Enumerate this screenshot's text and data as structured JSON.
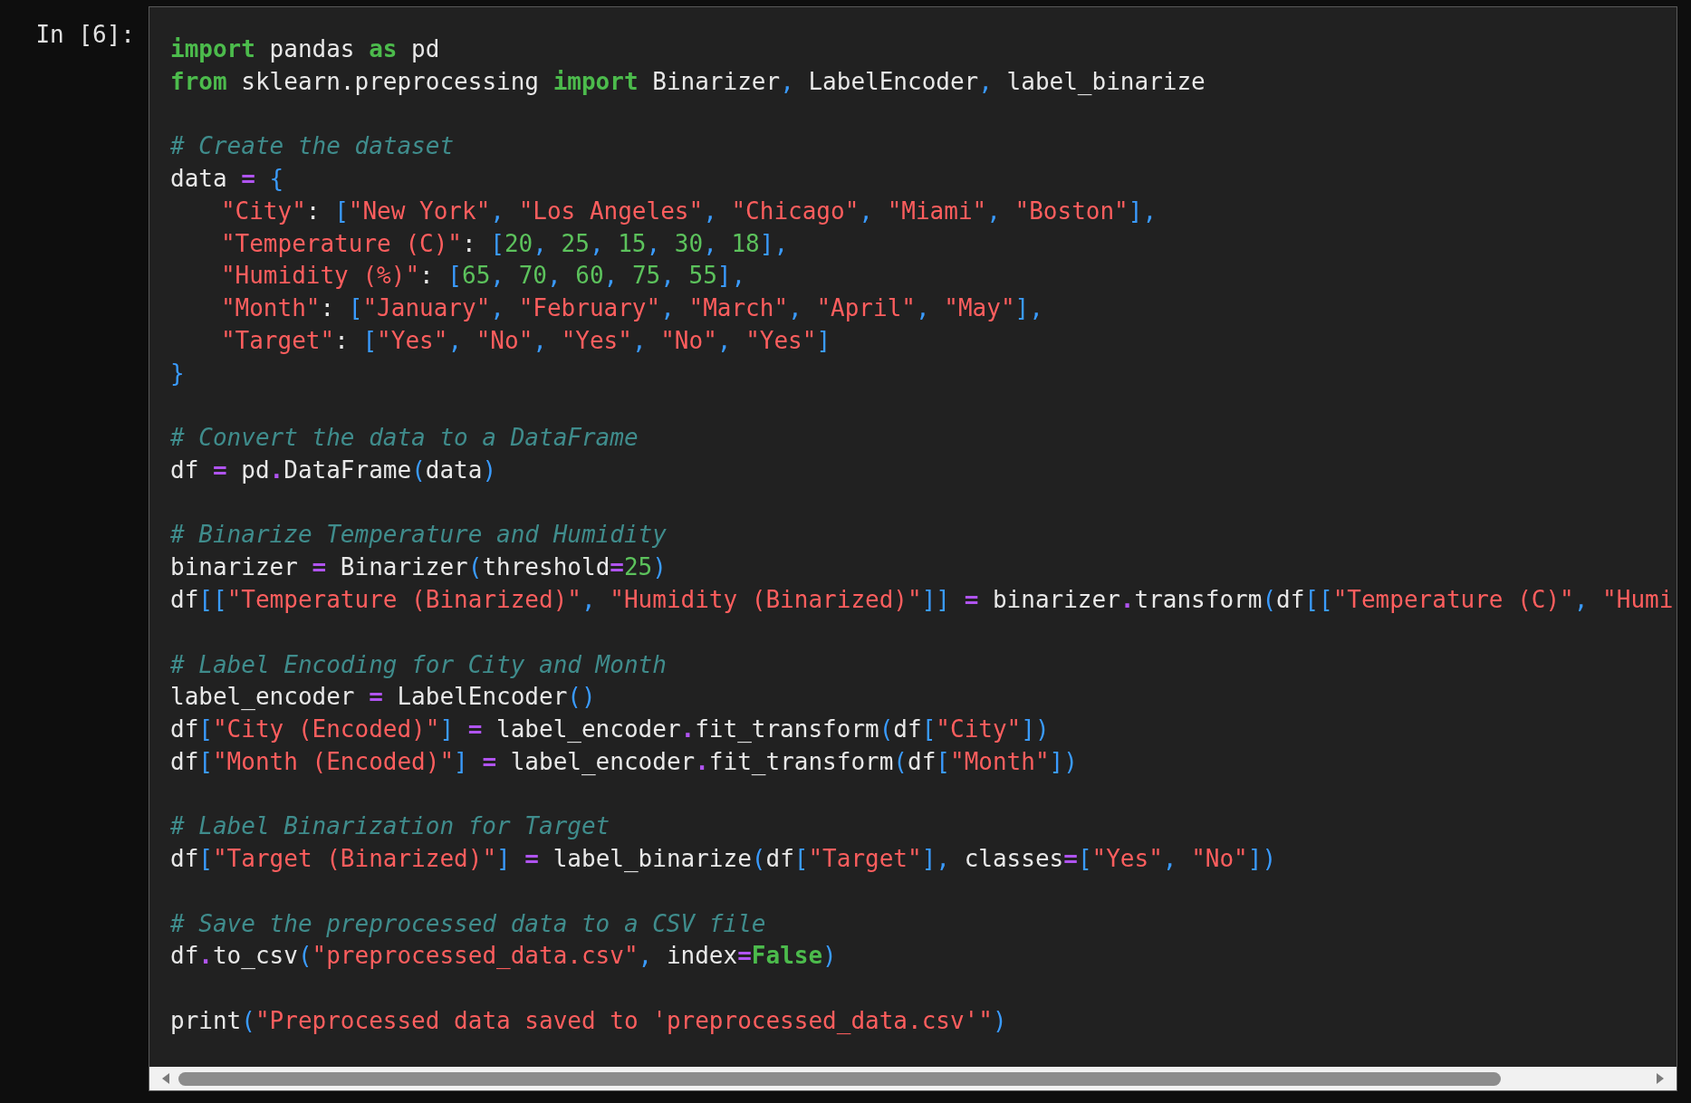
{
  "prompt": "In [6]:",
  "lines": [
    {
      "kind": "code",
      "tokens": [
        {
          "kind": "kw",
          "text": "import"
        },
        {
          "kind": "plain",
          "text": " pandas "
        },
        {
          "kind": "kw",
          "text": "as"
        },
        {
          "kind": "plain",
          "text": " pd"
        }
      ]
    },
    {
      "kind": "code",
      "tokens": [
        {
          "kind": "kw",
          "text": "from"
        },
        {
          "kind": "plain",
          "text": " sklearn.preprocessing "
        },
        {
          "kind": "kw",
          "text": "import"
        },
        {
          "kind": "plain",
          "text": " Binarizer"
        },
        {
          "kind": "punct",
          "text": ", "
        },
        {
          "kind": "plain",
          "text": "LabelEncoder"
        },
        {
          "kind": "punct",
          "text": ", "
        },
        {
          "kind": "plain",
          "text": "label_binarize"
        }
      ]
    },
    {
      "kind": "blank"
    },
    {
      "kind": "code",
      "tokens": [
        {
          "kind": "comment",
          "text": "# Create the dataset"
        }
      ]
    },
    {
      "kind": "code",
      "tokens": [
        {
          "kind": "plain",
          "text": "data "
        },
        {
          "kind": "op",
          "text": "="
        },
        {
          "kind": "punct",
          "text": " {"
        }
      ]
    },
    {
      "kind": "code",
      "indented": true,
      "tokens": [
        {
          "kind": "str",
          "text": "\"City\""
        },
        {
          "kind": "plain",
          "text": ": "
        },
        {
          "kind": "punct",
          "text": "["
        },
        {
          "kind": "str",
          "text": "\"New York\""
        },
        {
          "kind": "punct",
          "text": ", "
        },
        {
          "kind": "str",
          "text": "\"Los Angeles\""
        },
        {
          "kind": "punct",
          "text": ", "
        },
        {
          "kind": "str",
          "text": "\"Chicago\""
        },
        {
          "kind": "punct",
          "text": ", "
        },
        {
          "kind": "str",
          "text": "\"Miami\""
        },
        {
          "kind": "punct",
          "text": ", "
        },
        {
          "kind": "str",
          "text": "\"Boston\""
        },
        {
          "kind": "punct",
          "text": "],"
        }
      ]
    },
    {
      "kind": "code",
      "indented": true,
      "tokens": [
        {
          "kind": "str",
          "text": "\"Temperature (C)\""
        },
        {
          "kind": "plain",
          "text": ": "
        },
        {
          "kind": "punct",
          "text": "["
        },
        {
          "kind": "num",
          "text": "20"
        },
        {
          "kind": "punct",
          "text": ", "
        },
        {
          "kind": "num",
          "text": "25"
        },
        {
          "kind": "punct",
          "text": ", "
        },
        {
          "kind": "num",
          "text": "15"
        },
        {
          "kind": "punct",
          "text": ", "
        },
        {
          "kind": "num",
          "text": "30"
        },
        {
          "kind": "punct",
          "text": ", "
        },
        {
          "kind": "num",
          "text": "18"
        },
        {
          "kind": "punct",
          "text": "],"
        }
      ]
    },
    {
      "kind": "code",
      "indented": true,
      "tokens": [
        {
          "kind": "str",
          "text": "\"Humidity (%)\""
        },
        {
          "kind": "plain",
          "text": ": "
        },
        {
          "kind": "punct",
          "text": "["
        },
        {
          "kind": "num",
          "text": "65"
        },
        {
          "kind": "punct",
          "text": ", "
        },
        {
          "kind": "num",
          "text": "70"
        },
        {
          "kind": "punct",
          "text": ", "
        },
        {
          "kind": "num",
          "text": "60"
        },
        {
          "kind": "punct",
          "text": ", "
        },
        {
          "kind": "num",
          "text": "75"
        },
        {
          "kind": "punct",
          "text": ", "
        },
        {
          "kind": "num",
          "text": "55"
        },
        {
          "kind": "punct",
          "text": "],"
        }
      ]
    },
    {
      "kind": "code",
      "indented": true,
      "tokens": [
        {
          "kind": "str",
          "text": "\"Month\""
        },
        {
          "kind": "plain",
          "text": ": "
        },
        {
          "kind": "punct",
          "text": "["
        },
        {
          "kind": "str",
          "text": "\"January\""
        },
        {
          "kind": "punct",
          "text": ", "
        },
        {
          "kind": "str",
          "text": "\"February\""
        },
        {
          "kind": "punct",
          "text": ", "
        },
        {
          "kind": "str",
          "text": "\"March\""
        },
        {
          "kind": "punct",
          "text": ", "
        },
        {
          "kind": "str",
          "text": "\"April\""
        },
        {
          "kind": "punct",
          "text": ", "
        },
        {
          "kind": "str",
          "text": "\"May\""
        },
        {
          "kind": "punct",
          "text": "],"
        }
      ]
    },
    {
      "kind": "code",
      "indented": true,
      "tokens": [
        {
          "kind": "str",
          "text": "\"Target\""
        },
        {
          "kind": "plain",
          "text": ": "
        },
        {
          "kind": "punct",
          "text": "["
        },
        {
          "kind": "str",
          "text": "\"Yes\""
        },
        {
          "kind": "punct",
          "text": ", "
        },
        {
          "kind": "str",
          "text": "\"No\""
        },
        {
          "kind": "punct",
          "text": ", "
        },
        {
          "kind": "str",
          "text": "\"Yes\""
        },
        {
          "kind": "punct",
          "text": ", "
        },
        {
          "kind": "str",
          "text": "\"No\""
        },
        {
          "kind": "punct",
          "text": ", "
        },
        {
          "kind": "str",
          "text": "\"Yes\""
        },
        {
          "kind": "punct",
          "text": "]"
        }
      ]
    },
    {
      "kind": "code",
      "tokens": [
        {
          "kind": "punct",
          "text": "}"
        }
      ]
    },
    {
      "kind": "blank"
    },
    {
      "kind": "code",
      "tokens": [
        {
          "kind": "comment",
          "text": "# Convert the data to a DataFrame"
        }
      ]
    },
    {
      "kind": "code",
      "tokens": [
        {
          "kind": "plain",
          "text": "df "
        },
        {
          "kind": "op",
          "text": "="
        },
        {
          "kind": "plain",
          "text": " pd"
        },
        {
          "kind": "op",
          "text": "."
        },
        {
          "kind": "plain",
          "text": "DataFrame"
        },
        {
          "kind": "punct",
          "text": "("
        },
        {
          "kind": "plain",
          "text": "data"
        },
        {
          "kind": "punct",
          "text": ")"
        }
      ]
    },
    {
      "kind": "blank"
    },
    {
      "kind": "code",
      "tokens": [
        {
          "kind": "comment",
          "text": "# Binarize Temperature and Humidity"
        }
      ]
    },
    {
      "kind": "code",
      "tokens": [
        {
          "kind": "plain",
          "text": "binarizer "
        },
        {
          "kind": "op",
          "text": "="
        },
        {
          "kind": "plain",
          "text": " Binarizer"
        },
        {
          "kind": "punct",
          "text": "("
        },
        {
          "kind": "plain",
          "text": "threshold"
        },
        {
          "kind": "op",
          "text": "="
        },
        {
          "kind": "num",
          "text": "25"
        },
        {
          "kind": "punct",
          "text": ")"
        }
      ]
    },
    {
      "kind": "code",
      "tokens": [
        {
          "kind": "plain",
          "text": "df"
        },
        {
          "kind": "punct",
          "text": "[["
        },
        {
          "kind": "str",
          "text": "\"Temperature (Binarized)\""
        },
        {
          "kind": "punct",
          "text": ", "
        },
        {
          "kind": "str",
          "text": "\"Humidity (Binarized)\""
        },
        {
          "kind": "punct",
          "text": "]] "
        },
        {
          "kind": "op",
          "text": "="
        },
        {
          "kind": "plain",
          "text": " binarizer"
        },
        {
          "kind": "op",
          "text": "."
        },
        {
          "kind": "plain",
          "text": "transform"
        },
        {
          "kind": "punct",
          "text": "("
        },
        {
          "kind": "plain",
          "text": "df"
        },
        {
          "kind": "punct",
          "text": "[["
        },
        {
          "kind": "str",
          "text": "\"Temperature (C)\""
        },
        {
          "kind": "punct",
          "text": ", "
        },
        {
          "kind": "str",
          "text": "\"Humi"
        }
      ]
    },
    {
      "kind": "blank"
    },
    {
      "kind": "code",
      "tokens": [
        {
          "kind": "comment",
          "text": "# Label Encoding for City and Month"
        }
      ]
    },
    {
      "kind": "code",
      "tokens": [
        {
          "kind": "plain",
          "text": "label_encoder "
        },
        {
          "kind": "op",
          "text": "="
        },
        {
          "kind": "plain",
          "text": " LabelEncoder"
        },
        {
          "kind": "punct",
          "text": "()"
        }
      ]
    },
    {
      "kind": "code",
      "tokens": [
        {
          "kind": "plain",
          "text": "df"
        },
        {
          "kind": "punct",
          "text": "["
        },
        {
          "kind": "str",
          "text": "\"City (Encoded)\""
        },
        {
          "kind": "punct",
          "text": "] "
        },
        {
          "kind": "op",
          "text": "="
        },
        {
          "kind": "plain",
          "text": " label_encoder"
        },
        {
          "kind": "op",
          "text": "."
        },
        {
          "kind": "plain",
          "text": "fit_transform"
        },
        {
          "kind": "punct",
          "text": "("
        },
        {
          "kind": "plain",
          "text": "df"
        },
        {
          "kind": "punct",
          "text": "["
        },
        {
          "kind": "str",
          "text": "\"City\""
        },
        {
          "kind": "punct",
          "text": "])"
        }
      ]
    },
    {
      "kind": "code",
      "tokens": [
        {
          "kind": "plain",
          "text": "df"
        },
        {
          "kind": "punct",
          "text": "["
        },
        {
          "kind": "str",
          "text": "\"Month (Encoded)\""
        },
        {
          "kind": "punct",
          "text": "] "
        },
        {
          "kind": "op",
          "text": "="
        },
        {
          "kind": "plain",
          "text": " label_encoder"
        },
        {
          "kind": "op",
          "text": "."
        },
        {
          "kind": "plain",
          "text": "fit_transform"
        },
        {
          "kind": "punct",
          "text": "("
        },
        {
          "kind": "plain",
          "text": "df"
        },
        {
          "kind": "punct",
          "text": "["
        },
        {
          "kind": "str",
          "text": "\"Month\""
        },
        {
          "kind": "punct",
          "text": "])"
        }
      ]
    },
    {
      "kind": "blank"
    },
    {
      "kind": "code",
      "tokens": [
        {
          "kind": "comment",
          "text": "# Label Binarization for Target"
        }
      ]
    },
    {
      "kind": "code",
      "tokens": [
        {
          "kind": "plain",
          "text": "df"
        },
        {
          "kind": "punct",
          "text": "["
        },
        {
          "kind": "str",
          "text": "\"Target (Binarized)\""
        },
        {
          "kind": "punct",
          "text": "] "
        },
        {
          "kind": "op",
          "text": "="
        },
        {
          "kind": "plain",
          "text": " label_binarize"
        },
        {
          "kind": "punct",
          "text": "("
        },
        {
          "kind": "plain",
          "text": "df"
        },
        {
          "kind": "punct",
          "text": "["
        },
        {
          "kind": "str",
          "text": "\"Target\""
        },
        {
          "kind": "punct",
          "text": "], "
        },
        {
          "kind": "plain",
          "text": "classes"
        },
        {
          "kind": "op",
          "text": "="
        },
        {
          "kind": "punct",
          "text": "["
        },
        {
          "kind": "str",
          "text": "\"Yes\""
        },
        {
          "kind": "punct",
          "text": ", "
        },
        {
          "kind": "str",
          "text": "\"No\""
        },
        {
          "kind": "punct",
          "text": "])"
        }
      ]
    },
    {
      "kind": "blank"
    },
    {
      "kind": "code",
      "tokens": [
        {
          "kind": "comment",
          "text": "# Save the preprocessed data to a CSV file"
        }
      ]
    },
    {
      "kind": "code",
      "tokens": [
        {
          "kind": "plain",
          "text": "df"
        },
        {
          "kind": "op",
          "text": "."
        },
        {
          "kind": "plain",
          "text": "to_csv"
        },
        {
          "kind": "punct",
          "text": "("
        },
        {
          "kind": "str",
          "text": "\"preprocessed_data.csv\""
        },
        {
          "kind": "punct",
          "text": ", "
        },
        {
          "kind": "plain",
          "text": "index"
        },
        {
          "kind": "op",
          "text": "="
        },
        {
          "kind": "const",
          "text": "False"
        },
        {
          "kind": "punct",
          "text": ")"
        }
      ]
    },
    {
      "kind": "blank"
    },
    {
      "kind": "code",
      "tokens": [
        {
          "kind": "plain",
          "text": "print"
        },
        {
          "kind": "punct",
          "text": "("
        },
        {
          "kind": "str",
          "text": "\"Preprocessed data saved to 'preprocessed_data.csv'\""
        },
        {
          "kind": "punct",
          "text": ")"
        }
      ]
    }
  ]
}
